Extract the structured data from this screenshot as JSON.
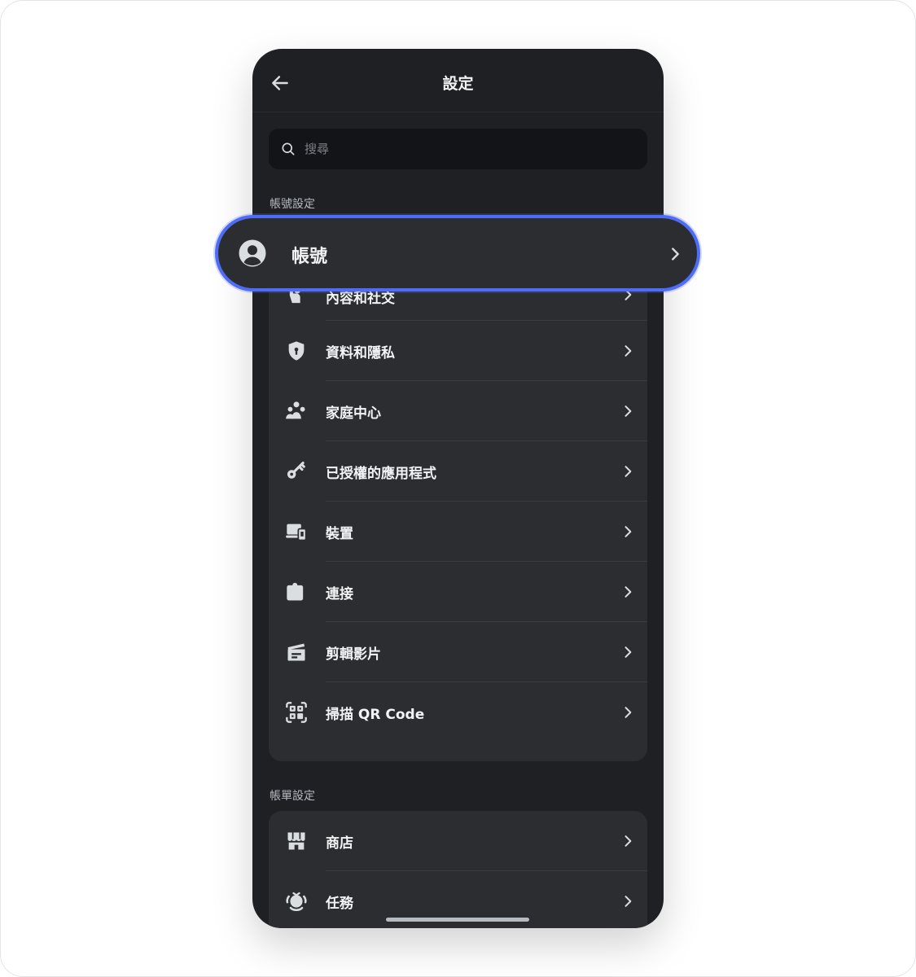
{
  "header": {
    "title": "設定"
  },
  "search": {
    "placeholder": "搜尋"
  },
  "sections": {
    "account_label": "帳號設定",
    "billing_label": "帳單設定"
  },
  "highlighted": {
    "label": "帳號",
    "icon": "user-circle-icon"
  },
  "account_items": [
    {
      "label": "內容和社交",
      "icon": "hand-wave-icon"
    },
    {
      "label": "資料和隱私",
      "icon": "shield-lock-icon"
    },
    {
      "label": "家庭中心",
      "icon": "family-icon"
    },
    {
      "label": "已授權的應用程式",
      "icon": "key-icon"
    },
    {
      "label": "裝置",
      "icon": "devices-icon"
    },
    {
      "label": "連接",
      "icon": "puzzle-icon"
    },
    {
      "label": "剪輯影片",
      "icon": "clapperboard-icon"
    },
    {
      "label": "掃描 QR Code",
      "icon": "qr-scan-icon"
    }
  ],
  "billing_items": [
    {
      "label": "商店",
      "icon": "shop-icon"
    },
    {
      "label": "任務",
      "icon": "quest-badge-icon"
    }
  ],
  "colors": {
    "accent": "#4e6cf5",
    "background": "#1f2023",
    "card": "#2b2d31"
  }
}
